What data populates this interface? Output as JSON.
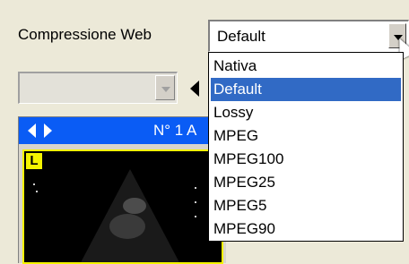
{
  "compression": {
    "label": "Compressione Web",
    "selected": "Default",
    "options": [
      "Nativa",
      "Default",
      "Lossy",
      "MPEG",
      "MPEG100",
      "MPEG25",
      "MPEG5",
      "MPEG90"
    ]
  },
  "panel": {
    "title": "N° 1 A",
    "badge": "L"
  },
  "colors": {
    "selection": "#316ac5",
    "panel_bar": "#0a5cf5",
    "badge": "#f4f400"
  }
}
